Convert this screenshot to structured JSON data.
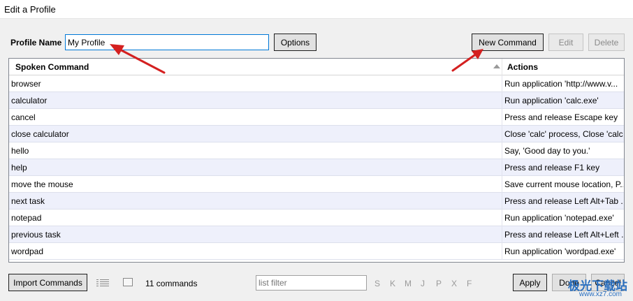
{
  "window": {
    "title": "Edit a Profile"
  },
  "profile": {
    "name_label": "Profile Name",
    "name_value": "My Profile",
    "options_label": "Options"
  },
  "toolbar": {
    "new_command_label": "New Command",
    "edit_label": "Edit",
    "delete_label": "Delete"
  },
  "table": {
    "columns": [
      "Spoken Command",
      "Actions"
    ],
    "rows": [
      {
        "command": "browser",
        "action": "Run application 'http://www.v..."
      },
      {
        "command": "calculator",
        "action": "Run application 'calc.exe'"
      },
      {
        "command": "cancel",
        "action": "Press and release Escape key"
      },
      {
        "command": "close calculator",
        "action": "Close 'calc' process, Close 'calc..."
      },
      {
        "command": "hello",
        "action": "Say, 'Good day to you.'"
      },
      {
        "command": "help",
        "action": "Press and release F1 key"
      },
      {
        "command": "move the mouse",
        "action": "Save current mouse location, P..."
      },
      {
        "command": "next task",
        "action": "Press and release Left Alt+Tab ..."
      },
      {
        "command": "notepad",
        "action": "Run application 'notepad.exe'"
      },
      {
        "command": "previous task",
        "action": "Press and release Left Alt+Left ..."
      },
      {
        "command": "wordpad",
        "action": "Run application 'wordpad.exe'"
      }
    ]
  },
  "footer": {
    "import_label": "Import Commands",
    "list_icon": "list-icon",
    "square_icon": "square-icon",
    "count_text": "11 commands",
    "filter_placeholder": "list filter",
    "letters": [
      "S",
      "K",
      "M",
      "J",
      "P",
      "X",
      "F"
    ],
    "apply_label": "Apply",
    "done_label": "Done",
    "cancel_label": "Cancel"
  },
  "watermark": {
    "text": "极光下载站",
    "url": "www.xz7.com"
  },
  "colors": {
    "arrow": "#d42020",
    "row_alt": "#eef0fb",
    "focus_border": "#0078d7"
  }
}
